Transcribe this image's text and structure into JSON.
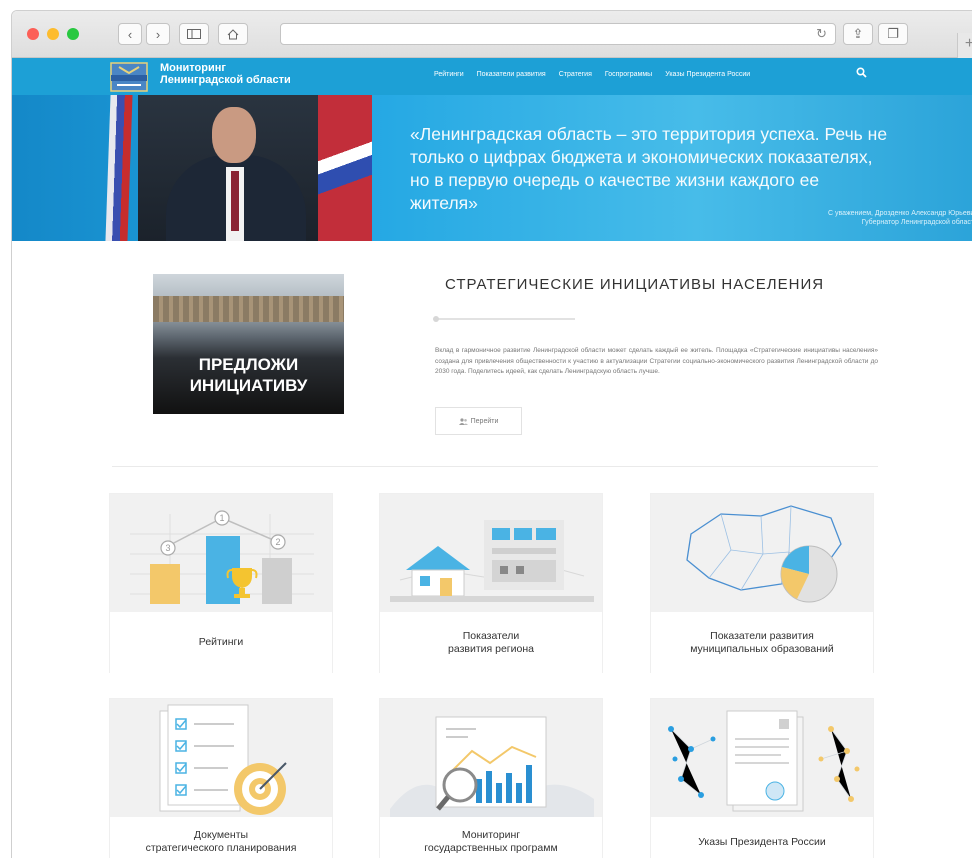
{
  "browser": {
    "back_glyph": "‹",
    "forward_glyph": "›",
    "reload_glyph": "↻",
    "share_glyph": "⇪",
    "tabs_glyph": "❐",
    "plus_glyph": "+",
    "colors": {
      "close": "#fc5f57",
      "minimize": "#fdbc2e",
      "maximize": "#28c840"
    }
  },
  "header": {
    "title_line1": "Мониторинг",
    "title_line2": "Ленинградской области",
    "nav": [
      "Рейтинги",
      "Показатели развития",
      "Стратегия",
      "Госпрограммы",
      "Указы Президента России"
    ],
    "search_icon": "search-icon",
    "brand_color": "#1da0d6"
  },
  "banner": {
    "quote": "«Ленинградская область – это территория успеха. Речь не только о цифрах бюджета и экономических показателях, но в первую очередь о качестве жизни каждого ее жителя»",
    "author_line1": "С уважением, Дрозденко Александр Юрьевич",
    "author_line2": "Губернатор Ленинградской области"
  },
  "promo": {
    "text_line1": "ПРЕДЛОЖИ",
    "text_line2": "ИНИЦИАТИВУ"
  },
  "strategy": {
    "title": "СТРАТЕГИЧЕСКИЕ ИНИЦИАТИВЫ НАСЕЛЕНИЯ",
    "text": "Вклад в гармоничное развитие Ленинградской области может сделать каждый ее житель. Площадка «Стратегические инициативы населения» создана для привлечения общественности к участию в актуализации Стратегии социально-экономического развития Ленинградской области до 2030 года. Поделитесь идеей, как сделать Ленинградскую область лучше.",
    "button_label": "Перейти",
    "button_icon": "users-icon"
  },
  "cards": [
    {
      "line1": "Рейтинги",
      "line2": ""
    },
    {
      "line1": "Показатели",
      "line2": "развития региона"
    },
    {
      "line1": "Показатели развития",
      "line2": "муниципальных образований"
    },
    {
      "line1": "Документы",
      "line2": "стратегического планирования"
    },
    {
      "line1": "Мониторинг",
      "line2": "государственных программ"
    },
    {
      "line1": "Указы Президента России",
      "line2": ""
    }
  ],
  "ratings_ranks": [
    "1",
    "2",
    "3"
  ]
}
